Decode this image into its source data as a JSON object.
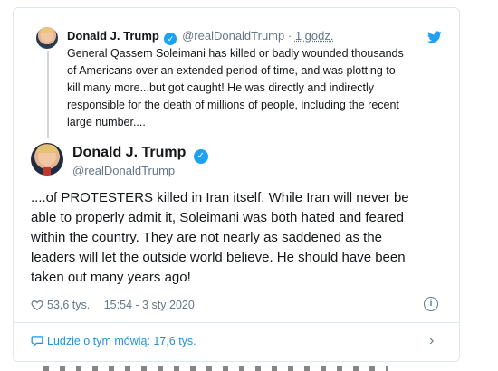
{
  "parent_tweet": {
    "name": "Donald J. Trump",
    "handle": "@realDonaldTrump",
    "separator": "·",
    "time": "1 godz.",
    "lines": [
      "General Qassem Soleimani has killed or badly wounded thousands",
      "of Americans over an extended period of time, and was plotting to",
      "kill many more...but got caught! He was directly and indirectly",
      "responsible for the death of millions of people, including the recent",
      "large number...."
    ]
  },
  "main_tweet": {
    "name": "Donald J. Trump",
    "handle": "@realDonaldTrump",
    "lines": [
      "....of PROTESTERS killed in Iran itself. While Iran will never be",
      "able to properly admit it, Soleimani was both hated and feared",
      "within the country. They are not nearly as saddened as the",
      "leaders will let the outside world believe. He should have been",
      "taken out many years ago!"
    ],
    "likes": "53,6 tys.",
    "timestamp": "15:54 - 3 sty 2020"
  },
  "footer": {
    "discussion_label": "Ludzie o tym mówią: 17,6 tys."
  },
  "colors": {
    "accent": "#1da1f2",
    "link": "#1b95e0",
    "muted": "#657786",
    "border": "#e1e8ed"
  },
  "icons": [
    "verified-badge-icon",
    "twitter-bird-icon",
    "heart-icon",
    "info-icon",
    "speech-bubble-icon",
    "chevron-right-icon"
  ]
}
